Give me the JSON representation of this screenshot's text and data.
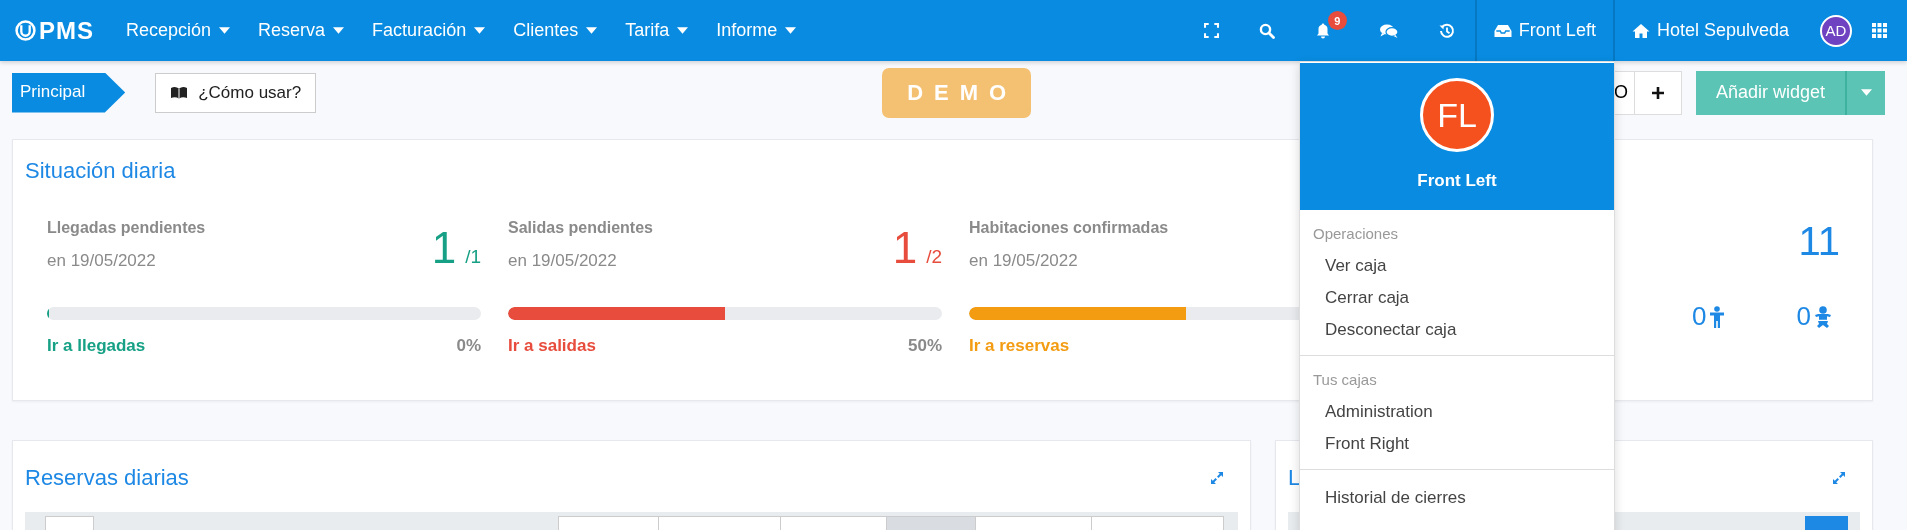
{
  "topbar": {
    "logo": "PMS",
    "menu": [
      {
        "label": "Recepción"
      },
      {
        "label": "Reserva"
      },
      {
        "label": "Facturación"
      },
      {
        "label": "Clientes"
      },
      {
        "label": "Tarifa"
      },
      {
        "label": "Informe"
      }
    ],
    "notification_count": "9",
    "cash_register": "Front Left",
    "hotel": "Hotel Sepulveda",
    "avatar": "AD"
  },
  "toolbar": {
    "breadcrumb": "Principal",
    "help_button": "¿Cómo usar?",
    "badge": "DEMO",
    "partial_button": "O",
    "add_widget": "Añadir widget"
  },
  "daily_status": {
    "title": "Situación diaria",
    "stats": [
      {
        "title": "Llegadas pendientes",
        "date": "en 19/05/2022",
        "count": "1",
        "total": "/1",
        "level": 0,
        "percent": "0%",
        "link": "Ir a llegadas",
        "color": "#16a085"
      },
      {
        "title": "Salidas pendientes",
        "date": "en 19/05/2022",
        "count": "1",
        "total": "/2",
        "level": 0.5,
        "percent": "50%",
        "link": "Ir a salidas",
        "color": "#e74c3c"
      },
      {
        "title": "Habitaciones confirmadas",
        "date": "en 19/05/2022",
        "level": 0.5,
        "link": "Ir a reservas",
        "color": "#f39c12"
      }
    ],
    "rooms": "11",
    "adults": "0",
    "children": "0"
  },
  "panels": [
    {
      "title": "Reservas diarias",
      "view_tabs": [
        {
          "selected": false
        },
        {
          "selected": false
        },
        {
          "selected": false
        },
        {
          "selected": true
        },
        {
          "selected": false
        },
        {
          "selected": false
        }
      ]
    },
    {
      "title": "L"
    }
  ],
  "cash_menu": {
    "avatar": "FL",
    "name": "Front Left",
    "sections": [
      {
        "heading": "Operaciones",
        "items": [
          "Ver caja",
          "Cerrar caja",
          "Desconectar caja"
        ]
      },
      {
        "heading": "Tus cajas",
        "items": [
          "Administration",
          "Front Right"
        ]
      },
      {
        "items": [
          "Historial de cierres"
        ]
      }
    ]
  }
}
